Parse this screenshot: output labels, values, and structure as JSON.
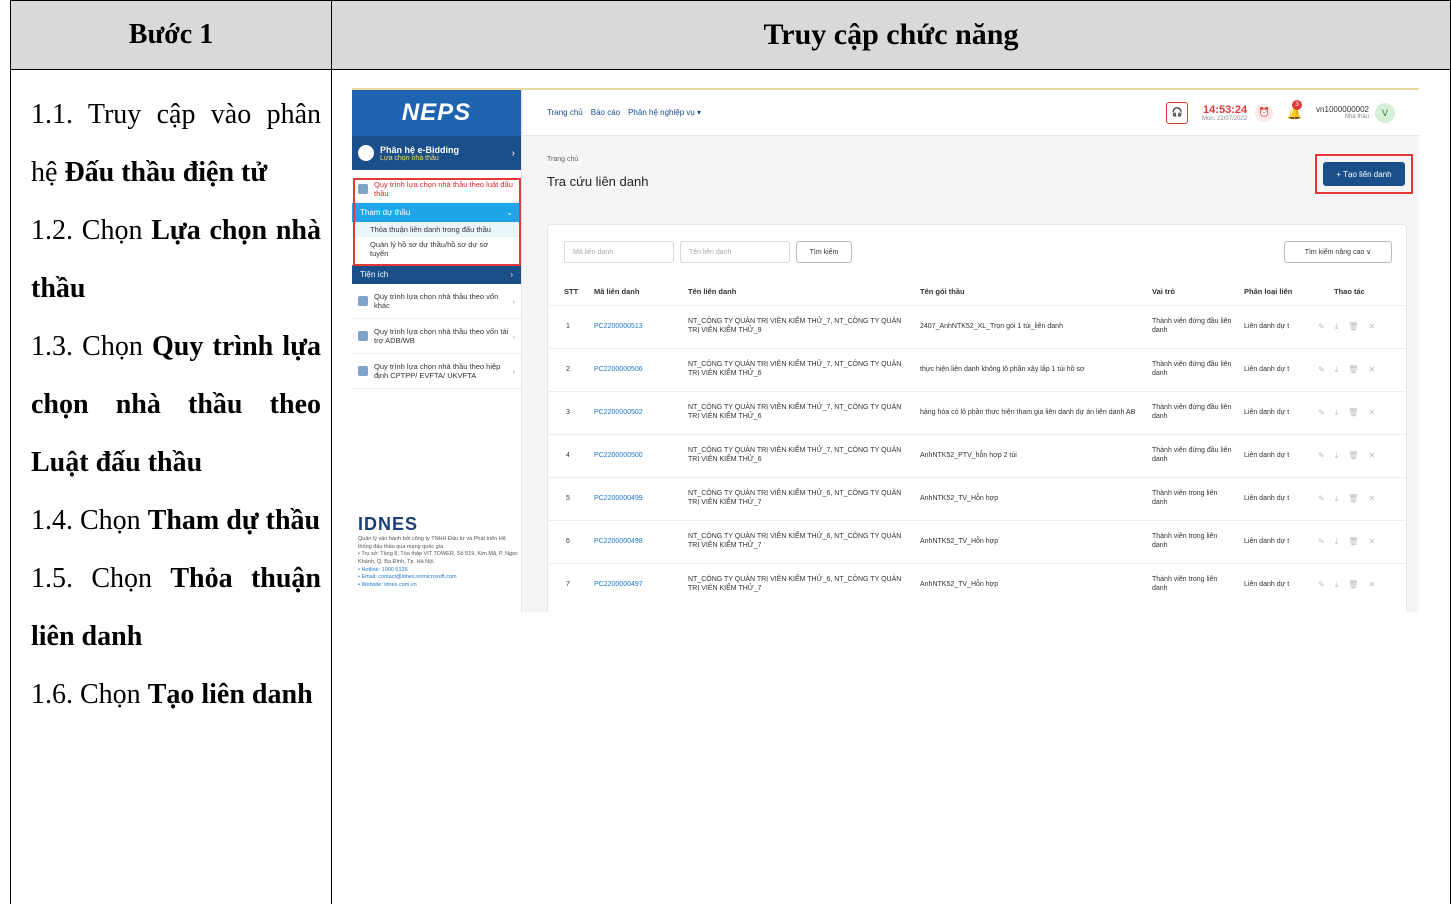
{
  "header": {
    "col1": "Bước 1",
    "col2": "Truy cập chức năng"
  },
  "steps": [
    {
      "pre": "1.1. Truy cập vào phân hệ ",
      "bold": "Đấu thầu điện tử"
    },
    {
      "pre": "1.2. Chọn ",
      "bold": "Lựa chọn nhà thầu"
    },
    {
      "pre": "1.3. Chọn ",
      "bold": "Quy trình lựa chọn nhà thầu theo Luật đấu thầu"
    },
    {
      "pre": "1.4. Chọn ",
      "bold": "Tham dự thầu"
    },
    {
      "pre": "1.5. Chọn ",
      "bold": "Thỏa thuận liên danh"
    },
    {
      "pre": "1.6. Chọn ",
      "bold": "Tạo liên danh"
    }
  ],
  "app": {
    "logo": "NEPS",
    "module": {
      "title": "Phân hệ e-Bidding",
      "subtitle": "Lựa chọn nhà thầu"
    },
    "menu_red": "Quy trình lựa chọn nhà thầu theo luật đấu thầu",
    "menu_bar": "Tham dự thầu",
    "sub1": "Thỏa thuận liên danh trong đấu thầu",
    "sub2": "Quản lý hồ sơ dự thầu/hồ sơ dự sơ tuyển",
    "bar2": "Tiện ích",
    "menu_items": [
      "Quy trình lựa chọn nhà thầu theo vốn khác",
      "Quy trình lựa chọn nhà thầu theo vốn tài trợ ADB/WB",
      "Quy trình lựa chọn nhà thầu theo hiệp định CPTPP/ EVFTA/ UKVFTA"
    ],
    "company": "IDNES",
    "footer": [
      "Quản lý vận hành bởi công ty TNHH Đầu tư và Phát triển Hệ thống đấu thầu qua mạng quốc gia",
      "• Trụ sở: Tầng 8, Tòa tháp VIT TOWER, Số 519, Kim Mã, P. Ngọc Khánh, Q. Ba Đình, Tp. Hà Nội.",
      "• Hotline: 1900 6126",
      "• Email: contact@idnes.onmicrosoft.com",
      "• Website: idnes.com.vn"
    ],
    "nav": [
      "Trang chủ",
      "Báo cáo",
      "Phân hệ nghiệp vụ ▾"
    ],
    "time": "14:53:24",
    "date": "Mon, 22/07/2022",
    "notif_count": "3",
    "user": "vn1000000002",
    "role": "Nhà thầu",
    "avatar": "V",
    "breadcrumb": "Trang chủ",
    "page_title": "Tra cứu liên danh",
    "create_btn": "+ Tạo liên danh",
    "ph_code": "Mã liên danh",
    "ph_name": "Tên liên danh",
    "search_btn": "Tìm kiếm",
    "adv_search": "Tìm kiếm nâng cao ∨",
    "columns": [
      "STT",
      "Mã liên danh",
      "Tên liên danh",
      "Tên gói thầu",
      "Vai trò",
      "Phân loại liên",
      "Thao tác"
    ],
    "rows": [
      {
        "stt": "1",
        "code": "PC2200000513",
        "name": "NT_CÔNG TY QUẢN TRỊ VIÊN KIỂM THỬ_7, NT_CÔNG TY QUẢN TRỊ VIÊN KIỂM THỬ_9",
        "pkg": "2407_AnhNTK52_XL_Trọn gói 1 túi_liên danh",
        "role": "Thành viên đứng đầu liên danh",
        "type": "Liên danh dự t"
      },
      {
        "stt": "2",
        "code": "PC2200000506",
        "name": "NT_CÔNG TY QUẢN TRỊ VIÊN KIỂM THỬ_7, NT_CÔNG TY QUẢN TRỊ VIÊN KIỂM THỬ_6",
        "pkg": "thực hiện liên danh không lô phần xây lắp 1 túi hồ sơ",
        "role": "Thành viên đứng đầu liên danh",
        "type": "Liên danh dự t"
      },
      {
        "stt": "3",
        "code": "PC2200000502",
        "name": "NT_CÔNG TY QUẢN TRỊ VIÊN KIỂM THỬ_7, NT_CÔNG TY QUẢN TRỊ VIÊN KIỂM THỬ_6",
        "pkg": "hàng hóa có lô phần thực hiện tham gia liên danh dự án liên danh AB",
        "role": "Thành viên đứng đầu liên danh",
        "type": "Liên danh dự t"
      },
      {
        "stt": "4",
        "code": "PC2200000500",
        "name": "NT_CÔNG TY QUẢN TRỊ VIÊN KIỂM THỬ_7, NT_CÔNG TY QUẢN TRỊ VIÊN KIỂM THỬ_6",
        "pkg": "AnhNTK52_PTV_hỗn hợp 2 túi",
        "role": "Thành viên đứng đầu liên danh",
        "type": "Liên danh dự t"
      },
      {
        "stt": "5",
        "code": "PC2200000499",
        "name": "NT_CÔNG TY QUẢN TRỊ VIÊN KIỂM THỬ_6, NT_CÔNG TY QUẢN TRỊ VIÊN KIỂM THỬ_7",
        "pkg": "AnhNTK52_TV_Hỗn hợp",
        "role": "Thành viên trong liên danh",
        "type": "Liên danh dự t"
      },
      {
        "stt": "6",
        "code": "PC2200000498",
        "name": "NT_CÔNG TY QUẢN TRỊ VIÊN KIỂM THỬ_6, NT_CÔNG TY QUẢN TRỊ VIÊN KIỂM THỬ_7",
        "pkg": "AnhNTK52_TV_Hỗn hợp",
        "role": "Thành viên trong liên danh",
        "type": "Liên danh dự t"
      },
      {
        "stt": "7",
        "code": "PC2200000497",
        "name": "NT_CÔNG TY QUẢN TRỊ VIÊN KIỂM THỬ_6, NT_CÔNG TY QUẢN TRỊ VIÊN KIỂM THỬ_7",
        "pkg": "AnhNTK52_TV_Hỗn hợp",
        "role": "Thành viên trong liên danh",
        "type": "Liên danh dự t"
      }
    ]
  }
}
